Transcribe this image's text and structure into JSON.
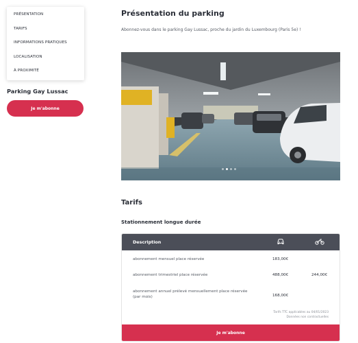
{
  "sidebar": {
    "nav": [
      {
        "label": "Présentation"
      },
      {
        "label": "Tarifs"
      },
      {
        "label": "Informations pratiques"
      },
      {
        "label": "Localisation"
      },
      {
        "label": "À proximité"
      }
    ],
    "parking_name": "Parking Gay Lussac",
    "subscribe_label": "Je m'abonne"
  },
  "main": {
    "title": "Présentation du parking",
    "intro": "Abonnez-vous dans le parking Gay Lussac, proche du jardin du Luxembourg (Paris 5e) !",
    "carousel": {
      "slide_count": 4,
      "active_index": 1
    },
    "tarifs_title": "Tarifs",
    "section_title": "Stationnement longue durée",
    "table": {
      "header": {
        "description": "Description",
        "car_icon": "car-icon",
        "moto_icon": "motorcycle-icon"
      },
      "rows": [
        {
          "label": "abonnement mensuel place réservée",
          "car": "183,00€",
          "moto": ""
        },
        {
          "label": "abonnement trimestriel place réservée",
          "car": "488,00€",
          "moto": "244,00€"
        },
        {
          "label": "abonnement annuel prélevé mensuellement place réservée (par mois)",
          "car": "168,00€",
          "moto": ""
        }
      ],
      "note_line1": "Tarifs TTC applicables au 04/01/2023",
      "note_line2": "Données non contractuelles",
      "subscribe_label": "Je m'abonne"
    }
  },
  "colors": {
    "accent": "#d6304f",
    "table_header": "#4b4e58",
    "text": "#2b2f38"
  }
}
